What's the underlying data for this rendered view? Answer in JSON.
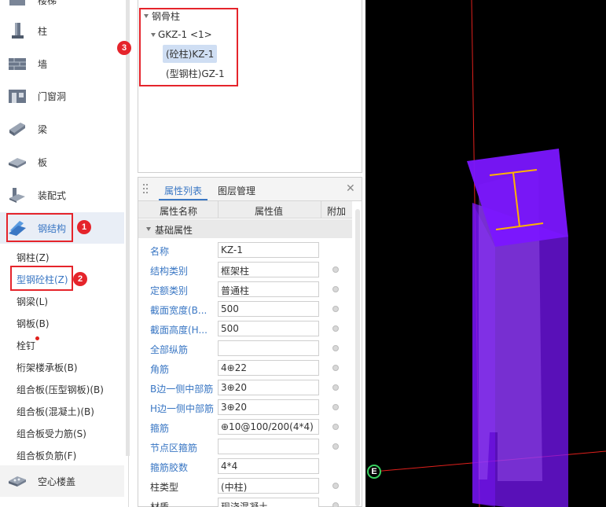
{
  "sidebar": {
    "categories": [
      {
        "label": "楼梯",
        "icon": "stair-icon"
      },
      {
        "label": "柱",
        "icon": "column-icon"
      },
      {
        "label": "墙",
        "icon": "wall-icon"
      },
      {
        "label": "门窗洞",
        "icon": "door-window-icon"
      },
      {
        "label": "梁",
        "icon": "beam-icon"
      },
      {
        "label": "板",
        "icon": "slab-icon"
      },
      {
        "label": "装配式",
        "icon": "prefab-icon"
      },
      {
        "label": "钢结构",
        "icon": "steel-structure-icon"
      },
      {
        "label": "空心楼盖",
        "icon": "hollow-floor-icon"
      }
    ],
    "sub_items": [
      "钢柱(Z)",
      "型钢砼柱(Z)",
      "钢梁(L)",
      "钢板(B)",
      "栓钉",
      "桁架楼承板(B)",
      "组合板(压型钢板)(B)",
      "组合板(混凝土)(B)",
      "组合板受力筋(S)",
      "组合板负筋(F)"
    ],
    "active_category": "钢结构",
    "active_sub": "型钢砼柱(Z)"
  },
  "badges": [
    "1",
    "2",
    "3"
  ],
  "tree": {
    "root": "钢骨柱",
    "group": "GKZ-1 <1>",
    "children": [
      "(砼柱)KZ-1",
      "(型钢柱)GZ-1"
    ]
  },
  "props": {
    "tabs": [
      "属性列表",
      "图层管理"
    ],
    "headers": [
      "属性名称",
      "属性值",
      "附加"
    ],
    "group_label": "基础属性",
    "rows": [
      {
        "name": "名称",
        "value": "KZ-1",
        "check": false
      },
      {
        "name": "结构类别",
        "value": "框架柱",
        "check": true
      },
      {
        "name": "定额类别",
        "value": "普通柱",
        "check": true
      },
      {
        "name": "截面宽度(B...",
        "value": "500",
        "check": true
      },
      {
        "name": "截面高度(H...",
        "value": "500",
        "check": true
      },
      {
        "name": "全部纵筋",
        "value": "",
        "check": true
      },
      {
        "name": "角筋",
        "value": "4⊕22",
        "check": true
      },
      {
        "name": "B边一侧中部筋",
        "value": "3⊕20",
        "check": true
      },
      {
        "name": "H边一侧中部筋",
        "value": "3⊕20",
        "check": true
      },
      {
        "name": "箍筋",
        "value": "⊕10@100/200(4*4)",
        "check": true
      },
      {
        "name": "节点区箍筋",
        "value": "",
        "check": true
      },
      {
        "name": "箍筋胶数",
        "value": "4*4",
        "check": false
      },
      {
        "name": "柱类型",
        "value": "(中柱)",
        "check": true
      },
      {
        "name": "材质",
        "value": "现浇混凝土",
        "check": true
      }
    ]
  },
  "viewport": {
    "axis_label": "E",
    "column_color": "#7b16ff",
    "steel_color": "#ffb400",
    "axis_line_color": "#e0201c"
  }
}
